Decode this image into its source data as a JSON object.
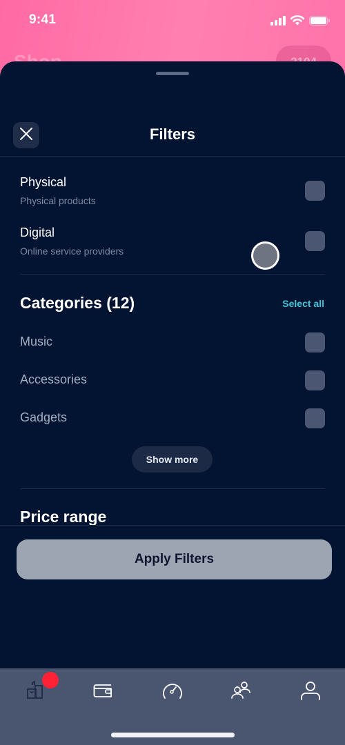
{
  "status_bar": {
    "time": "9:41",
    "icons": [
      "cellular-signal-icon",
      "wifi-icon",
      "battery-icon"
    ]
  },
  "background_screen": {
    "title": "Shop",
    "pill_text": "2104"
  },
  "sheet": {
    "title": "Filters",
    "close_icon": "close-icon",
    "type_options": [
      {
        "title": "Physical",
        "subtitle": "Physical products",
        "checked": false
      },
      {
        "title": "Digital",
        "subtitle": "Online service providers",
        "checked": false
      }
    ],
    "categories": {
      "title": "Categories (12)",
      "select_all_label": "Select all",
      "items": [
        {
          "label": "Music",
          "checked": false
        },
        {
          "label": "Accessories",
          "checked": false
        },
        {
          "label": "Gadgets",
          "checked": false
        }
      ],
      "show_more_label": "Show more"
    },
    "price_range": {
      "title": "Price range"
    },
    "apply_label": "Apply Filters"
  },
  "tab_bar": {
    "items": [
      {
        "name": "shop",
        "icon": "shopping-bag-icon",
        "active": true,
        "has_badge": true
      },
      {
        "name": "wallet",
        "icon": "wallet-icon",
        "active": false
      },
      {
        "name": "dashboard",
        "icon": "speedometer-icon",
        "active": false
      },
      {
        "name": "community",
        "icon": "users-icon",
        "active": false
      },
      {
        "name": "profile",
        "icon": "user-icon",
        "active": false
      }
    ]
  },
  "colors": {
    "sheet_background": "#021432",
    "accent": "#3fc6d9",
    "badge": "#ff2236",
    "tab_bar": "#4a5670",
    "header_gradient": "#ff6aa4"
  }
}
